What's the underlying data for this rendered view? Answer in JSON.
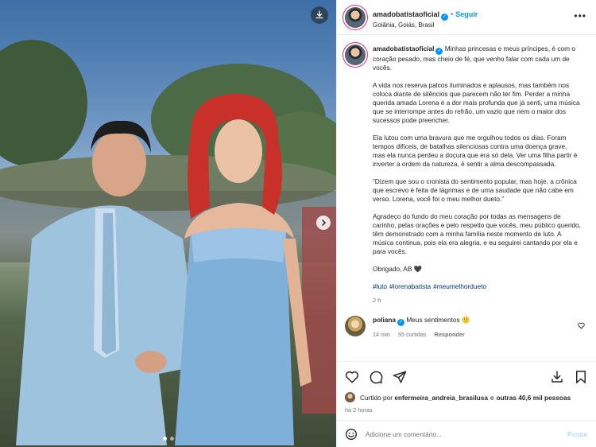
{
  "post": {
    "username": "amadobatistaoficial",
    "follow_label": "Seguir",
    "separator": "•",
    "location": "Goiânia, Goiás, Brasil",
    "more_label": "•••"
  },
  "caption": {
    "username": "amadobatistaoficial",
    "paragraphs": [
      "Minhas princesas e meus príncipes, é com o coração pesado, mas cheio de fé, que venho falar com cada um de vocês.",
      "A vida nos reserva palcos iluminados e aplausos, mas também nos coloca diante de silêncios que parecem não ter fim. Perder a minha querida amada Lorena é a dor mais profunda que já senti, uma música que se interrompe antes do refrão, um vazio que nem o maior dos sucessos pode preencher.",
      "Ela lutou com uma bravura que me orgulhou todos os dias. Foram tempos difíceis, de batalhas silenciosas contra uma doença grave, mas ela nunca perdeu a doçura que era só dela. Ver uma filha partir é inverter a ordem da natureza, é sentir a alma descompassada.",
      "“Dizem que sou o cronista do sentimento popular, mas hoje, a crônica que escrevo é feita de lágrimas e de uma saudade que não cabe em verso. Lorena, você foi o meu melhor dueto.”",
      "Agradeço do fundo do meu coração por todas as mensagens de carinho, pelas orações e pelo respeito que vocês, meu público querido, têm demonstrado com a minha família neste momento de luto. A música continua, pois ela era alegria, e eu seguirei cantando por ela e para vocês.",
      "Obrigado, AB 🖤"
    ],
    "hashtags": [
      "#luto",
      "#lorenabatista",
      "#meumelhordueto"
    ],
    "time": "2 h"
  },
  "comment": {
    "username": "poliana",
    "text": "Meus sentimentos 🙁",
    "time": "14 min",
    "likes": "55 curtidas",
    "reply": "Responder"
  },
  "likes": {
    "prefix": "Curtido por",
    "user": "enfermeira_andreia_brasilusa",
    "joiner": "e",
    "others": "outras 40,6 mil pessoas"
  },
  "posted": "há 2 horas",
  "add_comment": {
    "placeholder": "Adicione um comentário...",
    "post_label": "Postar"
  },
  "carousel": {
    "slides": 2,
    "active": 0
  },
  "colors": {
    "link": "#0095f6",
    "hashtag": "#00376b",
    "muted": "#737373"
  },
  "icons": [
    "download-icon",
    "chevron-right-icon",
    "verified-icon",
    "more-icon",
    "heart-icon",
    "comment-icon",
    "share-icon",
    "save-icon",
    "emoji-icon"
  ]
}
